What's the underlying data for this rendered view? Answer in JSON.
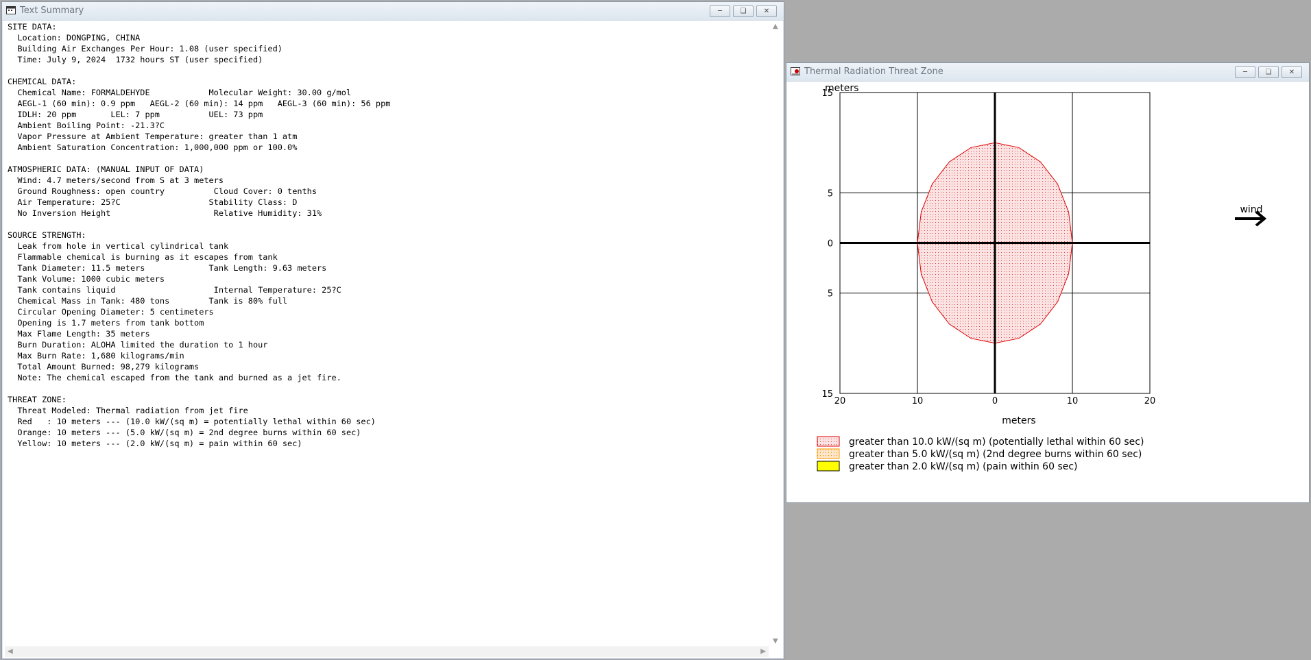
{
  "text_window": {
    "title": "Text Summary",
    "lines": [
      "SITE DATA:",
      "  Location: DONGPING, CHINA",
      "  Building Air Exchanges Per Hour: 1.08 (user specified)",
      "  Time: July 9, 2024  1732 hours ST (user specified)",
      "",
      "CHEMICAL DATA:",
      "  Chemical Name: FORMALDEHYDE            Molecular Weight: 30.00 g/mol",
      "  AEGL-1 (60 min): 0.9 ppm   AEGL-2 (60 min): 14 ppm   AEGL-3 (60 min): 56 ppm",
      "  IDLH: 20 ppm       LEL: 7 ppm          UEL: 73 ppm",
      "  Ambient Boiling Point: -21.3?C",
      "  Vapor Pressure at Ambient Temperature: greater than 1 atm",
      "  Ambient Saturation Concentration: 1,000,000 ppm or 100.0%",
      "",
      "ATMOSPHERIC DATA: (MANUAL INPUT OF DATA)",
      "  Wind: 4.7 meters/second from S at 3 meters",
      "  Ground Roughness: open country          Cloud Cover: 0 tenths",
      "  Air Temperature: 25?C                  Stability Class: D",
      "  No Inversion Height                     Relative Humidity: 31%",
      "",
      "SOURCE STRENGTH:",
      "  Leak from hole in vertical cylindrical tank",
      "  Flammable chemical is burning as it escapes from tank",
      "  Tank Diameter: 11.5 meters             Tank Length: 9.63 meters",
      "  Tank Volume: 1000 cubic meters",
      "  Tank contains liquid                    Internal Temperature: 25?C",
      "  Chemical Mass in Tank: 480 tons        Tank is 80% full",
      "  Circular Opening Diameter: 5 centimeters",
      "  Opening is 1.7 meters from tank bottom",
      "  Max Flame Length: 35 meters",
      "  Burn Duration: ALOHA limited the duration to 1 hour",
      "  Max Burn Rate: 1,680 kilograms/min",
      "  Total Amount Burned: 98,279 kilograms",
      "  Note: The chemical escaped from the tank and burned as a jet fire.",
      "",
      "THREAT ZONE:",
      "  Threat Modeled: Thermal radiation from jet fire",
      "  Red   : 10 meters --- (10.0 kW/(sq m) = potentially lethal within 60 sec)",
      "  Orange: 10 meters --- (5.0 kW/(sq m) = 2nd degree burns within 60 sec)",
      "  Yellow: 10 meters --- (2.0 kW/(sq m) = pain within 60 sec)"
    ]
  },
  "plot_window": {
    "title": "Thermal Radiation Threat Zone",
    "wind_label": "wind",
    "legend": [
      {
        "label": "greater than 10.0 kW/(sq m) (potentially lethal within 60 sec)",
        "color": "#e00000",
        "fill": "#fbe3e3"
      },
      {
        "label": "greater than 5.0 kW/(sq m) (2nd degree burns within 60 sec)",
        "color": "#ff9900",
        "fill": "#fde6c8"
      },
      {
        "label": "greater than 2.0 kW/(sq m) (pain within 60 sec)",
        "color": "#000000",
        "fill": "#ffff00"
      }
    ]
  },
  "chart_data": {
    "type": "area",
    "xlabel": "meters",
    "ylabel": "meters",
    "xlim": [
      -20,
      20
    ],
    "ylim": [
      -15,
      15
    ],
    "x_ticks": [
      {
        "value": -20,
        "label": "20"
      },
      {
        "value": -10,
        "label": "10"
      },
      {
        "value": 0,
        "label": "0"
      },
      {
        "value": 10,
        "label": "10"
      },
      {
        "value": 20,
        "label": "20"
      }
    ],
    "y_ticks": [
      {
        "value": 15,
        "label": "15"
      },
      {
        "value": 5,
        "label": "5"
      },
      {
        "value": 0,
        "label": "0"
      },
      {
        "value": -5,
        "label": "5"
      },
      {
        "value": -15,
        "label": "15"
      }
    ],
    "grid": true,
    "zones": [
      {
        "name": "Red",
        "radius_m": 10,
        "threshold": "10.0 kW/(sq m)",
        "color": "#e00000"
      }
    ]
  }
}
